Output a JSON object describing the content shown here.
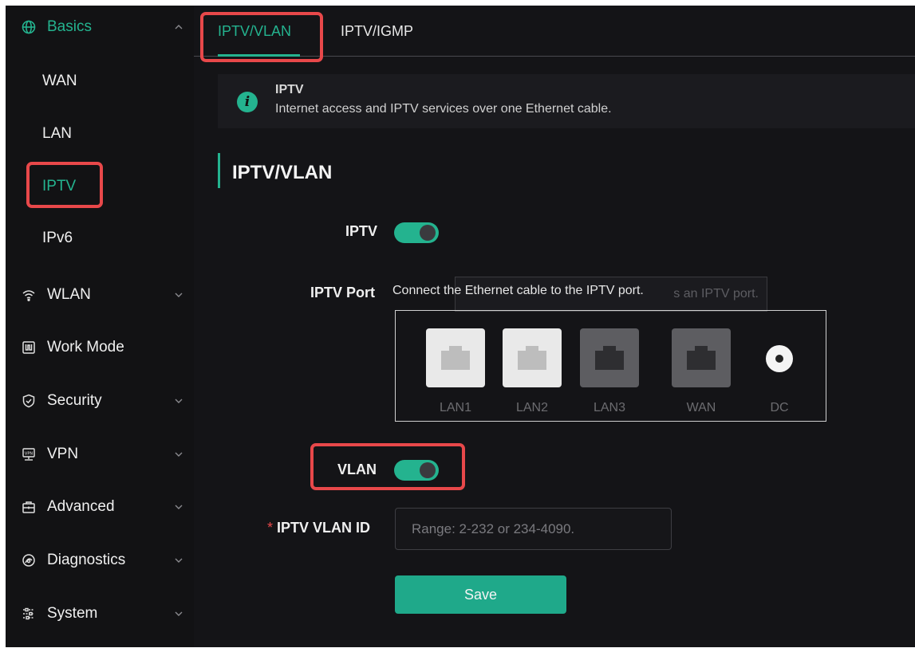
{
  "sidebar": {
    "basics": "Basics",
    "basics_items": [
      "WAN",
      "LAN",
      "IPTV",
      "IPv6"
    ],
    "groups": [
      "WLAN",
      "Work Mode",
      "Security",
      "VPN",
      "Advanced",
      "Diagnostics",
      "System"
    ]
  },
  "tabs": [
    "IPTV/VLAN",
    "IPTV/IGMP"
  ],
  "info": {
    "title": "IPTV",
    "description": "Internet access and IPTV services over one Ethernet cable."
  },
  "section_title": "IPTV/VLAN",
  "form": {
    "iptv_label": "IPTV",
    "iptv_enabled": true,
    "iptv_port_label": "IPTV Port",
    "iptv_port_hint": "Connect the Ethernet cable to the IPTV port.",
    "tooltip_ghost": "s an IPTV port.",
    "ports": [
      "LAN1",
      "LAN2",
      "LAN3",
      "WAN",
      "DC"
    ],
    "vlan_label": "VLAN",
    "vlan_enabled": true,
    "required_mark": "*",
    "vlan_id_label": "IPTV VLAN ID",
    "vlan_id_placeholder": "Range: 2-232 or 234-4090.",
    "vlan_id_value": "",
    "save_label": "Save"
  },
  "colors": {
    "accent": "#24b38f",
    "background": "#141417",
    "highlight": "#e8484a"
  }
}
